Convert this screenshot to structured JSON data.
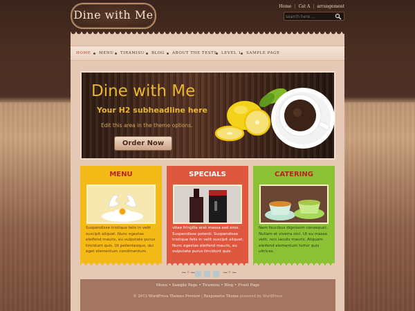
{
  "site": {
    "title": "Dine with Me"
  },
  "top_links": [
    "Home",
    "Cat A",
    "arrangement"
  ],
  "search": {
    "placeholder": "search here ..."
  },
  "nav": {
    "items": [
      "HOME",
      "MENU",
      "TIRAMISU",
      "BLOG",
      "ABOUT THE TESTS",
      "LEVEL 1",
      "SAMPLE PAGE"
    ],
    "active": "HOME"
  },
  "hero": {
    "title": "Dine with Me",
    "subtitle": "Your H2 subheadline here",
    "note": "Edit this area in the theme options.",
    "button": "Order Now"
  },
  "columns": [
    {
      "title": "MENU",
      "color": "#f4ba17",
      "text": "Suspendisse tristique felis in velit suscipit aliquet. Nunc egestas eleifend mauris, eu vulputate purus tincidunt quis. Ut pellentesque, dui eget elementum condimentum."
    },
    {
      "title": "SPECIALS",
      "color": "#e0573f",
      "text": "vitae fringilla erat massa sed eros. Suspendisse potenti. Suspendisse tristique felis in velit suscipit aliquet. Nunc egestas eleifend mauris, eu vulputate purus tincidunt quis."
    },
    {
      "title": "CATERING",
      "color": "#8cc136",
      "text": "Nam faucibus dignissim consequat. Nullam et viverra orci. Ut eu massa velit, non iaculis mauris. Aliquam eleifend elementum tortor quis ultrices."
    }
  ],
  "footer": {
    "links": [
      "Menu",
      "Sample Page",
      "Tiramisu",
      "Blog",
      "Front Page"
    ],
    "copyright_prefix": "© 2013 WordPress Themes Preview",
    "theme_credit": "Responsive Theme",
    "powered_by": "powered by WordPress"
  },
  "colors": {
    "accent_gold": "#e8b632",
    "nav_active": "#b33a22",
    "paper": "#e5c9b4"
  }
}
